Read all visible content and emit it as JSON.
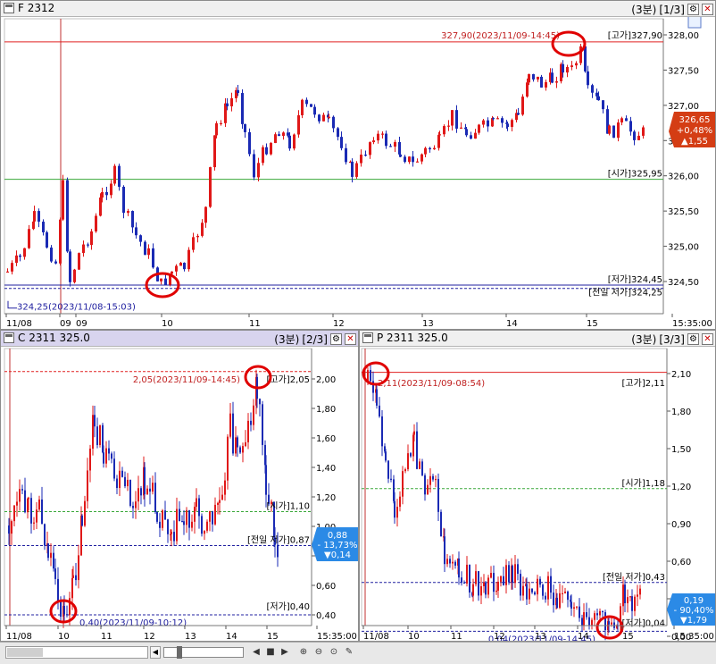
{
  "panel_top": {
    "title": "F 2312",
    "timeframe": "(3분)",
    "page": "[1/3]",
    "annotations": {
      "high_peak": "327,90(2023/11/09-14:45)",
      "high_label": "[고가]327,90",
      "open_label": "[시가]325,95",
      "low_label": "[저가]324,45",
      "prev_low_label": "[전일 저가]324,25",
      "low_point": "324,25(2023/11/08-15:03)"
    },
    "price_box": {
      "price": "326,65",
      "pct": "+0,48%",
      "change": "▲1,55"
    },
    "y_ticks": [
      "328,00",
      "327,50",
      "327,00",
      "326,50",
      "326,00",
      "325,50",
      "325,00",
      "324,50"
    ],
    "x_ticks": [
      "11/08",
      "09",
      "09",
      "10",
      "11",
      "12",
      "13",
      "14",
      "15",
      "15:35:00"
    ]
  },
  "panel_call": {
    "title": "C 2311 325.0",
    "timeframe": "(3분)",
    "page": "[2/3]",
    "annotations": {
      "high_peak": "2,05(2023/11/09-14:45)",
      "high_label": "[고가]2,05",
      "open_label": "[시가]1,10",
      "prev_low_label": "[전일 저가]0,87",
      "low_label": "[저가]0,40",
      "low_point": "0,40(2023/11/09-10:12)"
    },
    "price_box": {
      "price": "0,88",
      "pct": "- 13,73%",
      "change": "▼0,14"
    },
    "y_ticks": [
      "2,00",
      "1,80",
      "1,60",
      "1,40",
      "1,20",
      "1,00",
      "0,80",
      "0,60",
      "0,40"
    ],
    "x_ticks": [
      "11/08",
      "10",
      "11",
      "12",
      "13",
      "14",
      "15",
      "15:35:00"
    ]
  },
  "panel_put": {
    "title": "P 2311 325.0",
    "timeframe": "(3분)",
    "page": "[3/3]",
    "annotations": {
      "high_peak": "2,11(2023/11/09-08:54)",
      "high_label": "[고가]2,11",
      "open_label": "[시가]1,18",
      "prev_low_label": "[전일 저가]0,43",
      "low_label": "[저가]0,04",
      "low_point": "0,04(2023/11/09-14:45)"
    },
    "price_box": {
      "price": "0,19",
      "pct": "- 90,40%",
      "change": "▼1,79"
    },
    "y_ticks": [
      "2,10",
      "1,80",
      "1,50",
      "1,20",
      "0,90",
      "0,60",
      "0,30",
      "0,00"
    ],
    "x_ticks": [
      "11/08",
      "10",
      "11",
      "12",
      "13",
      "14",
      "15",
      "15:35:00"
    ]
  },
  "colors": {
    "up": "#e01818",
    "down": "#1a2ab4",
    "high_line": "#e02020",
    "open_line": "#3aa83a",
    "low_line": "#2020a0",
    "highlight_circle": "#e00000",
    "price_box_up": "#d43d14",
    "price_box_down": "#2b8ae6"
  }
}
